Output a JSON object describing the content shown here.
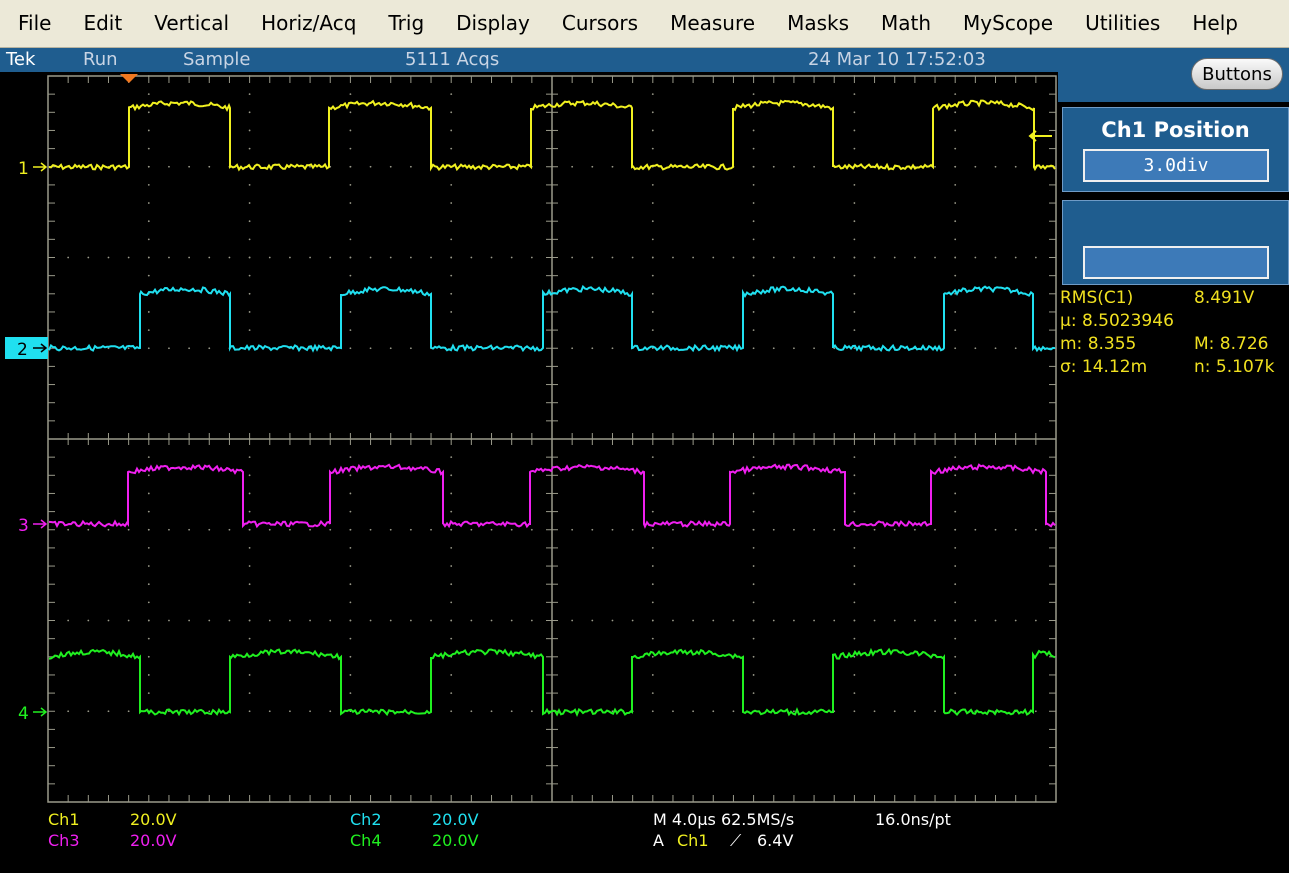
{
  "menu": [
    "File",
    "Edit",
    "Vertical",
    "Horiz/Acq",
    "Trig",
    "Display",
    "Cursors",
    "Measure",
    "Masks",
    "Math",
    "MyScope",
    "Utilities",
    "Help"
  ],
  "status": {
    "brand": "Tek",
    "run_state": "Run",
    "acq_mode": "Sample",
    "acq_count": "5111 Acqs",
    "datetime": "24 Mar 10 17:52:03"
  },
  "panel": {
    "buttons_label": "Buttons",
    "control_title": "Ch1 Position",
    "control_value": "3.0div"
  },
  "measurement": {
    "name": "RMS(C1)",
    "value": "8.491V",
    "mean": "μ: 8.5023946",
    "min": "m: 8.355",
    "max": "M: 8.726",
    "stddev": "σ: 14.12m",
    "count": "n: 5.107k"
  },
  "channels": [
    {
      "marker": "1",
      "color": "#f0f020",
      "label": "Ch1",
      "scale": "20.0V"
    },
    {
      "marker": "2",
      "color": "#20e0f0",
      "label": "Ch2",
      "scale": "20.0V"
    },
    {
      "marker": "3",
      "color": "#f020f0",
      "label": "Ch3",
      "scale": "20.0V"
    },
    {
      "marker": "4",
      "color": "#20f020",
      "label": "Ch4",
      "scale": "20.0V"
    }
  ],
  "horizontal": {
    "timebase": "M 4.0μs 62.5MS/s",
    "resolution": "16.0ns/pt"
  },
  "trigger": {
    "source_prefix": "A",
    "source": "Ch1",
    "slope": "⟋",
    "level": "6.4V"
  },
  "colors": {
    "menu_bg": "#ece9d8",
    "status_bg": "#1f5d8f",
    "grid": "#9a9a8a",
    "measurement_text": "#f0e020"
  }
}
